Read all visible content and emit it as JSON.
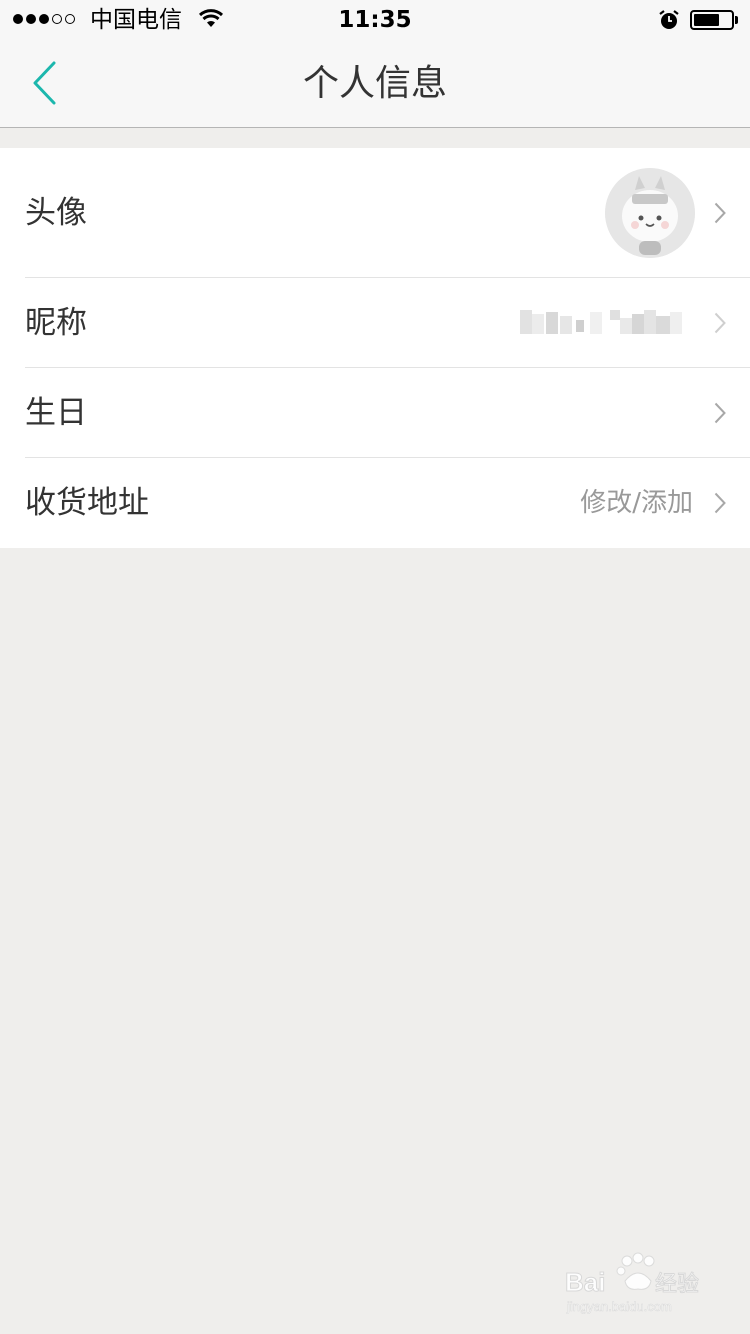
{
  "status_bar": {
    "carrier": "中国电信",
    "time": "11:35",
    "signal_bars_filled": 3,
    "signal_bars_total": 5,
    "battery_level": 0.7
  },
  "nav": {
    "title": "个人信息",
    "back_icon": "chevron-left-icon",
    "accent_color": "#1cb7ad"
  },
  "rows": [
    {
      "label": "头像",
      "value": "",
      "icon": "avatar-image"
    },
    {
      "label": "昵称",
      "value": "",
      "icon": "pixelated-nickname"
    },
    {
      "label": "生日",
      "value": ""
    },
    {
      "label": "收货地址",
      "value": "修改/添加"
    }
  ],
  "watermark": {
    "brand": "Baidu经验",
    "url": "jingyan.baidu.com"
  }
}
